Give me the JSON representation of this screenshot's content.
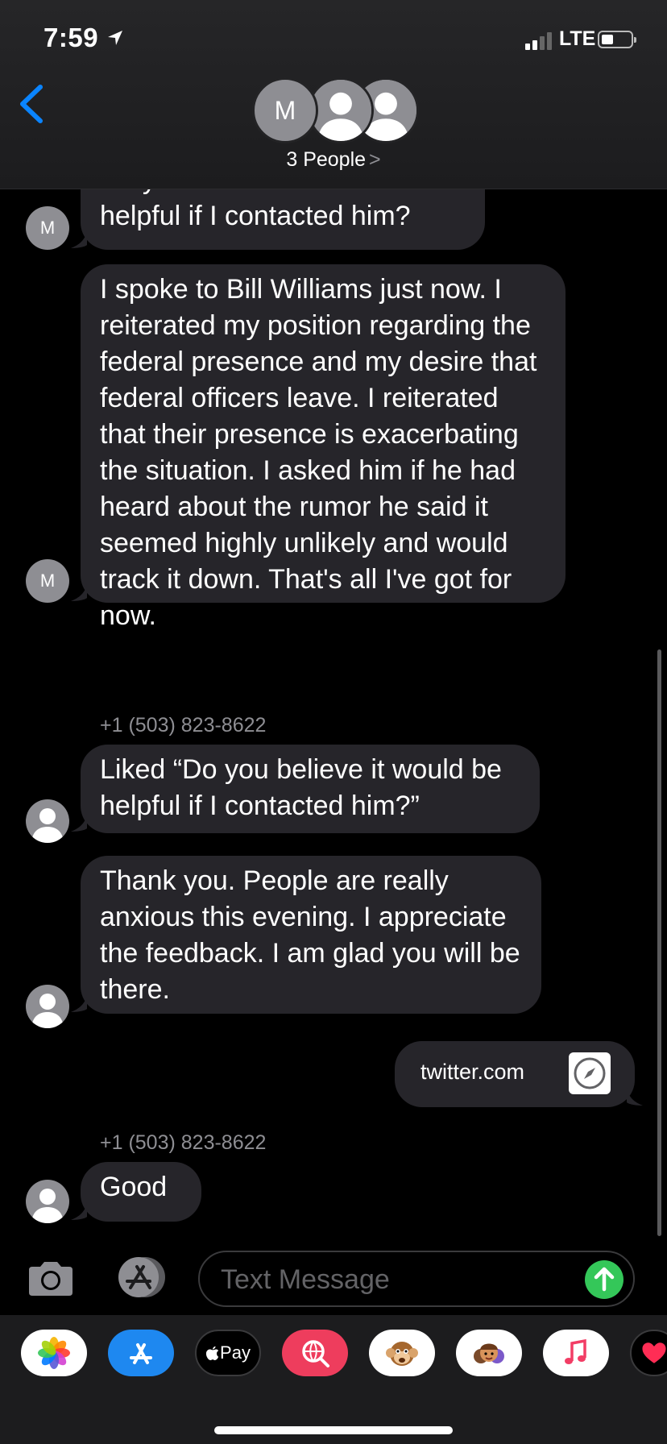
{
  "status_bar": {
    "time": "7:59",
    "network": "LTE"
  },
  "header": {
    "avatar_letter": "M",
    "group_label": "3 People",
    "chevron": ">"
  },
  "messages": [
    {
      "text": "Do you believe it would be helpful if I contacted him?",
      "avatar": "M"
    },
    {
      "text": "I spoke to Bill Williams  just now. I reiterated my position regarding the federal presence and my desire that federal officers  leave. I reiterated that their presence is exacerbating the situation. I asked him if he had heard about the rumor he said it seemed highly unlikely and would track it down. That's all I've got for now.",
      "avatar": "M"
    },
    {
      "sender": "+1 (503) 823-8622"
    },
    {
      "text": "Liked “Do you believe it would be helpful if I contacted him?”"
    },
    {
      "text": "Thank you.  People are really anxious this evening.  I appreciate the feedback.  I am glad you will be there."
    },
    {
      "text": "twitter.com",
      "link_icon": "compass-icon"
    },
    {
      "sender": "+1 (503) 823-8622"
    },
    {
      "text": "Good"
    }
  ],
  "input": {
    "placeholder": "Text Message"
  },
  "colors": {
    "accent": "#0a84ff",
    "bubble_gray": "#26252a",
    "send_green": "#34c759",
    "background": "#000000"
  },
  "app_drawer": [
    {
      "name": "photos-app-icon"
    },
    {
      "name": "app-store-icon"
    },
    {
      "name": "apple-pay-icon",
      "label": "Pay"
    },
    {
      "name": "web-search-icon"
    },
    {
      "name": "animoji-icon"
    },
    {
      "name": "memoji-icon"
    },
    {
      "name": "music-icon"
    },
    {
      "name": "digital-touch-icon"
    }
  ]
}
